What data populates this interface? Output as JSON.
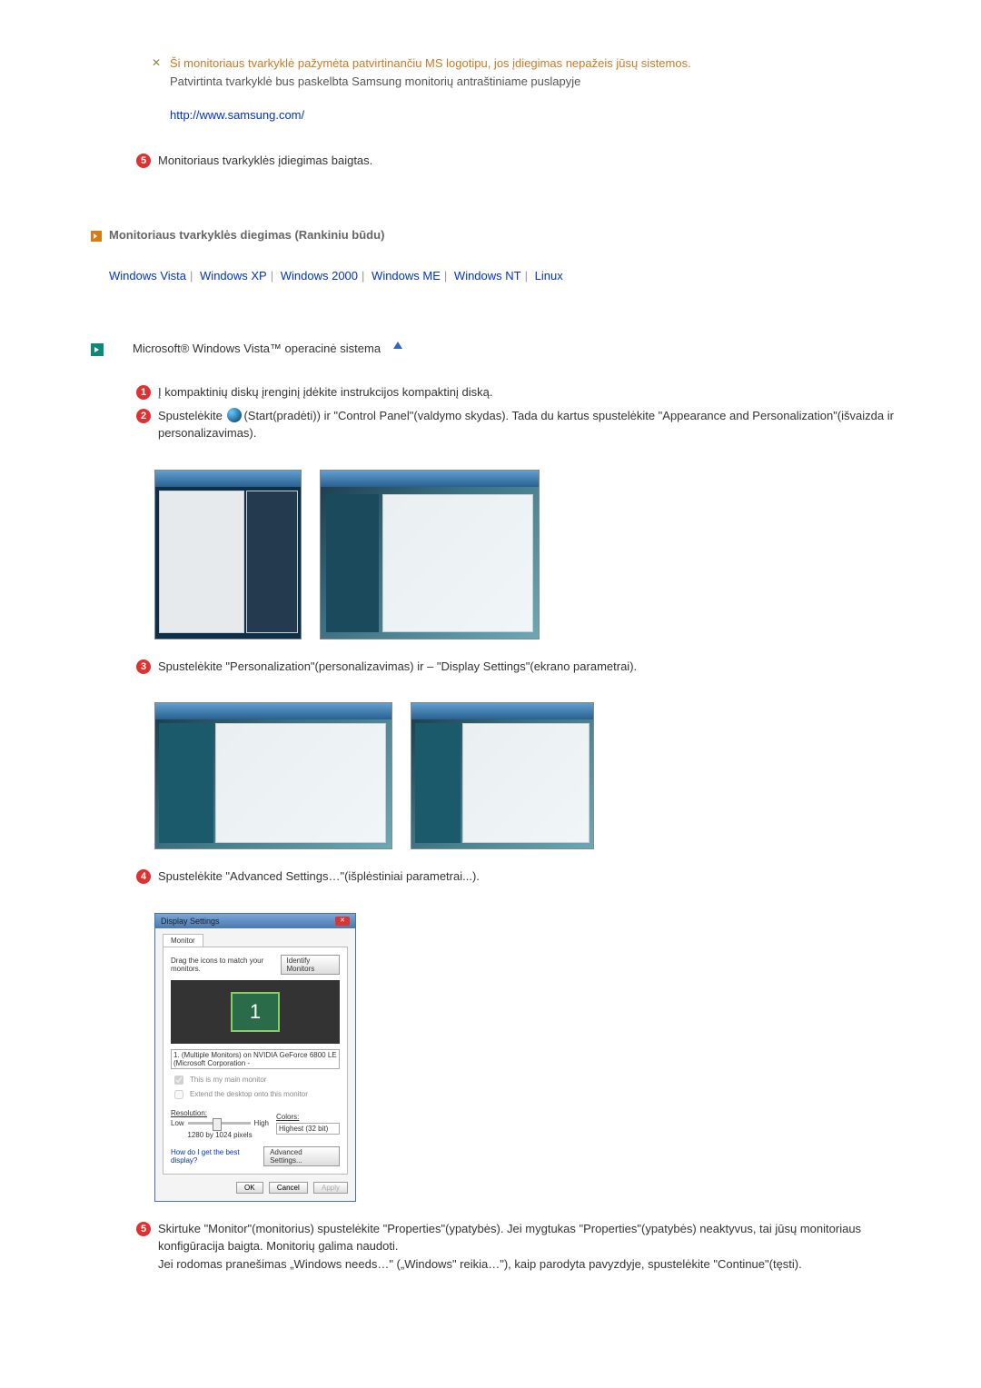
{
  "warning": {
    "line1": "Ši monitoriaus tvarkyklė pažymėta patvirtinančiu MS logotipu, jos įdiegimas nepažeis jūsų sistemos.",
    "line2": "Patvirtinta tvarkyklė bus paskelbta Samsung monitorių antraštiniame puslapyje",
    "link": "http://www.samsung.com/"
  },
  "step5_top": "Monitoriaus tvarkyklės įdiegimas baigtas.",
  "heading_manual": "Monitoriaus tvarkyklės diegimas (Rankiniu būdu)",
  "os_links": [
    "Windows Vista",
    "Windows XP",
    "Windows 2000",
    "Windows ME",
    "Windows NT",
    "Linux"
  ],
  "vista_heading": "Microsoft® Windows Vista™ operacinė sistema",
  "step1": "Į kompaktinių diskų įrenginį įdėkite instrukcijos kompaktinį diską.",
  "step2_a": "Spustelėkite ",
  "step2_b": "(Start(pradėti)) ir \"Control Panel\"(valdymo skydas). Tada du kartus spustelėkite \"Appearance and Personalization\"(išvaizda ir personalizavimas).",
  "step3": "Spustelėkite \"Personalization\"(personalizavimas) ir – \"Display Settings\"(ekrano parametrai).",
  "step4": "Spustelėkite \"Advanced Settings…\"(išplėstiniai parametrai...).",
  "step5": "Skirtuke \"Monitor\"(monitorius) spustelėkite \"Properties\"(ypatybės). Jei mygtukas \"Properties\"(ypatybės) neaktyvus, tai jūsų monitoriaus konfigūracija baigta. Monitorių galima naudoti.\nJei rodomas pranešimas „Windows needs…\" („Windows\" reikia…\"), kaip parodyta pavyzdyje, spustelėkite \"Continue\"(tęsti).",
  "display_settings": {
    "title": "Display Settings",
    "tab": "Monitor",
    "drag_text": "Drag the icons to match your monitors.",
    "identify": "Identify Monitors",
    "monitor_number": "1",
    "device_line": "1. (Multiple Monitors) on NVIDIA GeForce 6800 LE (Microsoft Corporation - ",
    "cb_main": "This is my main monitor",
    "cb_extend": "Extend the desktop onto this monitor",
    "resolution_label": "Resolution:",
    "low": "Low",
    "high": "High",
    "colors_label": "Colors:",
    "colors_value": "Highest (32 bit)",
    "res_value": "1280 by 1024 pixels",
    "best_link": "How do I get the best display?",
    "adv": "Advanced Settings...",
    "ok": "OK",
    "cancel": "Cancel",
    "apply": "Apply"
  }
}
